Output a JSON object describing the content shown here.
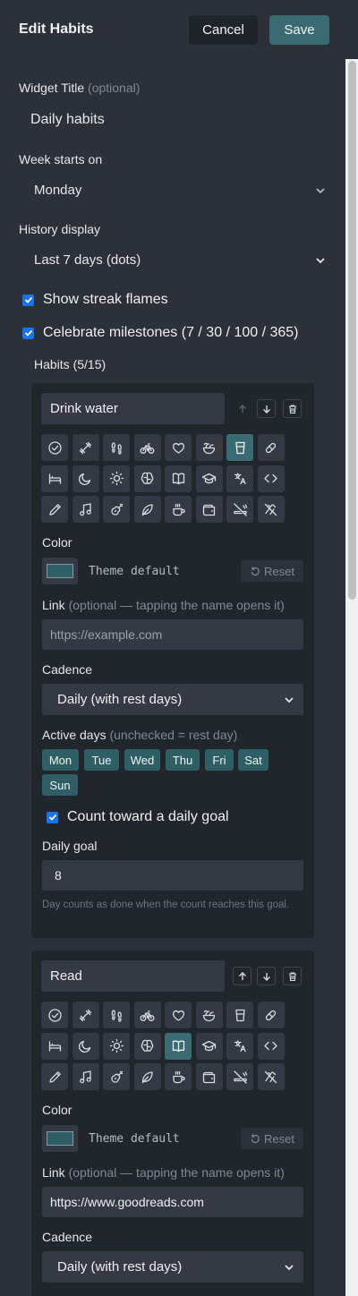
{
  "header": {
    "title": "Edit Habits",
    "cancel_label": "Cancel",
    "save_label": "Save"
  },
  "form": {
    "widget_title_label": "Widget Title",
    "widget_title_optional": "(optional)",
    "widget_title_value": "Daily habits",
    "week_starts_label": "Week starts on",
    "week_starts_value": "Monday",
    "history_label": "History display",
    "history_value": "Last 7 days (dots)",
    "show_streak_label": "Show streak flames",
    "show_streak_checked": true,
    "celebrate_label": "Celebrate milestones (7 / 30 / 100 / 365)",
    "celebrate_checked": true,
    "habits_heading": "Habits (5/15)"
  },
  "icons": [
    "check-circle",
    "dumbbell",
    "footprints",
    "bike",
    "heart",
    "salad",
    "glass",
    "pill",
    "bed",
    "moon",
    "sun",
    "brain",
    "book",
    "graduation-cap",
    "translate",
    "code",
    "pencil",
    "music",
    "guitar",
    "leaf",
    "coffee",
    "wallet",
    "no-smoking",
    "no-alcohol"
  ],
  "labels": {
    "color": "Color",
    "theme_default": "Theme default",
    "reset": "Reset",
    "link": "Link",
    "link_optional": "(optional — tapping the name opens it)",
    "link_placeholder": "https://example.com",
    "cadence": "Cadence",
    "active_days": "Active days",
    "active_days_optional": "(unchecked = rest day)",
    "count_goal": "Count toward a daily goal",
    "daily_goal": "Daily goal",
    "goal_help": "Day counts as done when the count reaches this goal."
  },
  "habits": [
    {
      "name": "Drink water",
      "selected_icon": "glass",
      "color_swatch": "#2e5e66",
      "link": "",
      "cadence": "Daily (with rest days)",
      "days": [
        "Mon",
        "Tue",
        "Wed",
        "Thu",
        "Fri",
        "Sat",
        "Sun"
      ],
      "count_goal_checked": true,
      "daily_goal": "8"
    },
    {
      "name": "Read",
      "selected_icon": "book",
      "color_swatch": "#2e5e66",
      "link": "https://www.goodreads.com",
      "cadence": "Daily (with rest days)"
    }
  ],
  "colors": {
    "background": "#2b3039",
    "card": "#21252c",
    "input": "#343943",
    "accent": "#3a6b73",
    "checkbox": "#1a73e8"
  }
}
